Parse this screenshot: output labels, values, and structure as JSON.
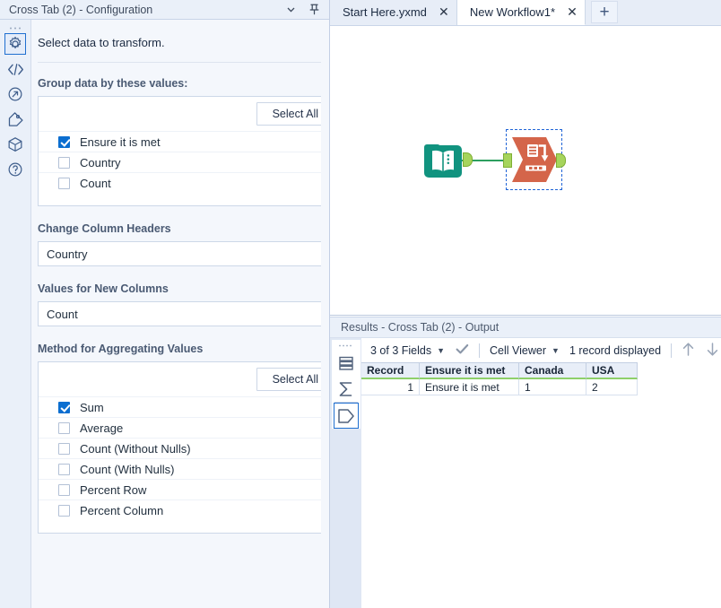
{
  "config_panel": {
    "title": "Cross Tab (2) - Configuration",
    "collapse_icon": "chevron-down-icon",
    "pin_icon": "pin-icon",
    "rail_icons": [
      {
        "name": "gear-icon",
        "active": true
      },
      {
        "name": "code-brackets-icon",
        "active": false
      },
      {
        "name": "circle-arrow-icon",
        "active": false
      },
      {
        "name": "tag-icon",
        "active": false
      },
      {
        "name": "package-icon",
        "active": false
      },
      {
        "name": "help-icon",
        "active": false
      }
    ],
    "intro_text": "Select data to transform.",
    "group_by": {
      "label": "Group data by these values:",
      "select_all_label": "Select All",
      "items": [
        {
          "label": "Ensure it is met",
          "checked": true
        },
        {
          "label": "Country",
          "checked": false
        },
        {
          "label": "Count",
          "checked": false
        }
      ]
    },
    "change_column_headers": {
      "label": "Change Column Headers",
      "value": "Country"
    },
    "values_for_new_columns": {
      "label": "Values for New Columns",
      "value": "Count"
    },
    "aggregating_method": {
      "label": "Method for Aggregating Values",
      "select_all_label": "Select All",
      "items": [
        {
          "label": "Sum",
          "checked": true
        },
        {
          "label": "Average",
          "checked": false
        },
        {
          "label": "Count (Without Nulls)",
          "checked": false
        },
        {
          "label": "Count (With Nulls)",
          "checked": false
        },
        {
          "label": "Percent Row",
          "checked": false
        },
        {
          "label": "Percent Column",
          "checked": false
        }
      ]
    }
  },
  "tabs": {
    "items": [
      {
        "label": "Start Here.yxmd",
        "active": false,
        "close": "✕"
      },
      {
        "label": "New Workflow1*",
        "active": true,
        "close": "✕"
      }
    ],
    "add_label": "+"
  },
  "canvas": {
    "nodes": [
      {
        "name": "input-data-tool",
        "tool": "book-icon",
        "selected": false
      },
      {
        "name": "cross-tab-tool",
        "tool": "cross-tab-icon",
        "selected": true
      }
    ]
  },
  "results": {
    "title": "Results - Cross Tab (2) - Output",
    "rail_icons": [
      {
        "name": "table-layers-icon",
        "active": false
      },
      {
        "name": "sigma-icon",
        "active": false
      },
      {
        "name": "output-anchor-icon",
        "active": true
      }
    ],
    "toolbar": {
      "fields_label": "3 of 3 Fields",
      "fields_caret": "▼",
      "check_icon": "checkmark-icon",
      "viewer_label": "Cell Viewer",
      "viewer_caret": "▼",
      "record_count_label": "1 record displayed",
      "up_icon": "arrow-up-icon",
      "down_icon": "arrow-down-icon"
    },
    "grid": {
      "columns": [
        "Record",
        "Ensure it is met",
        "Canada",
        "USA"
      ],
      "rows": [
        {
          "record": "1",
          "ensure_it_is_met": "Ensure it is met",
          "canada": "1",
          "usa": "2"
        }
      ]
    }
  },
  "colors": {
    "accent_blue": "#0b6ed0",
    "panel_bg": "#f4f7fc",
    "header_bg": "#eaf0f9",
    "node_green": "#11937f",
    "node_red": "#d4654a",
    "anchor_green": "#a6d45c",
    "grid_green": "#8ed06a"
  }
}
